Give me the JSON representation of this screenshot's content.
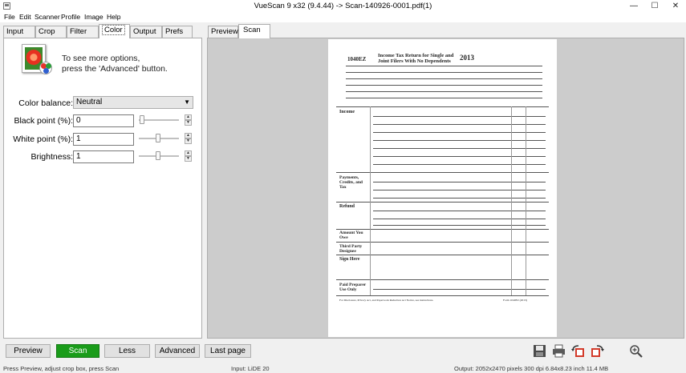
{
  "window": {
    "title": "VueScan 9 x32 (9.4.44) -> Scan-140926-0001.pdf(1)",
    "minimize_glyph": "—",
    "maximize_glyph": "☐",
    "close_glyph": "✕"
  },
  "menu": [
    "File",
    "Edit",
    "Scanner",
    "Profile",
    "Image",
    "Help"
  ],
  "tabs": [
    "Input",
    "Crop",
    "Filter",
    "Color",
    "Output",
    "Prefs"
  ],
  "active_tab": "Color",
  "color_panel": {
    "hint_line1": "To see more options,",
    "hint_line2": "press the 'Advanced' button.",
    "color_balance_label": "Color balance:",
    "color_balance_value": "Neutral",
    "black_point_label": "Black point (%):",
    "black_point_value": "0",
    "black_point_level": 0,
    "white_point_label": "White point (%):",
    "white_point_value": "1",
    "white_point_level": 0.5,
    "brightness_label": "Brightness:",
    "brightness_value": "1",
    "brightness_level": 0.5
  },
  "preview_tabs": [
    "Preview",
    "Scan"
  ],
  "active_preview_tab": "Scan",
  "document": {
    "form_number": "1040EZ",
    "form_title_line1": "Income Tax Return for Single and",
    "form_title_line2": "Joint Filers With No Dependents",
    "year": "2013",
    "section_income": "Income",
    "section_payments": "Payments, Credits, and Tax",
    "section_refund": "Refund",
    "section_amount_owed": "Amount You Owe",
    "section_third_party": "Third Party Designee",
    "section_sign": "Sign Here",
    "section_preparer": "Paid Preparer Use Only",
    "footer_text": "For Disclosure, Privacy Act, and Paperwork Reduction Act Notice, see instructions.",
    "footer_form": "Form 1040EZ (2013)"
  },
  "buttons": {
    "preview": "Preview",
    "scan": "Scan",
    "less": "Less",
    "advanced": "Advanced",
    "last_page": "Last page"
  },
  "toolbar_icons": [
    "save-icon",
    "print-icon",
    "rotate-left-icon",
    "rotate-right-icon",
    "zoom-icon"
  ],
  "status": {
    "left": "Press Preview, adjust crop box, press Scan",
    "middle": "Input: LiDE 20",
    "right": "Output: 2052x2470 pixels 300 dpi 6.84x8.23 inch 11.4 MB"
  }
}
